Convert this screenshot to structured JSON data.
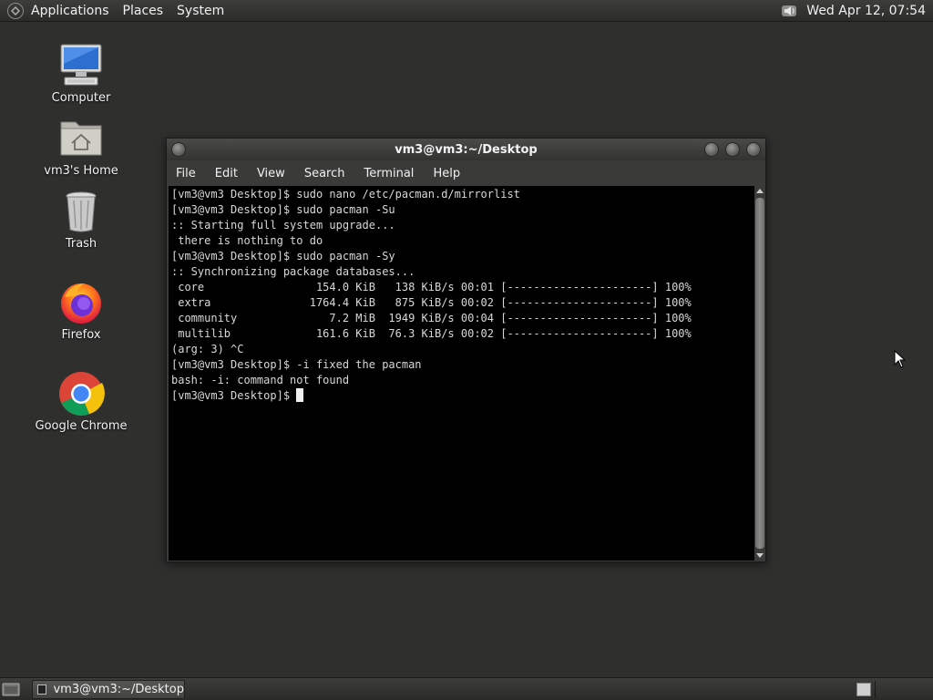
{
  "top_panel": {
    "menus": [
      "Applications",
      "Places",
      "System"
    ],
    "clock": "Wed Apr 12, 07:54"
  },
  "desktop": {
    "icons": [
      {
        "label": "Computer",
        "icon": "computer-icon"
      },
      {
        "label": "vm3's Home",
        "icon": "home-folder-icon"
      },
      {
        "label": "Trash",
        "icon": "trash-icon"
      },
      {
        "label": "Firefox",
        "icon": "firefox-icon"
      },
      {
        "label": "Google Chrome",
        "icon": "chrome-icon"
      }
    ]
  },
  "terminal": {
    "title": "vm3@vm3:~/Desktop",
    "menu": [
      "File",
      "Edit",
      "View",
      "Search",
      "Terminal",
      "Help"
    ],
    "lines": [
      "[vm3@vm3 Desktop]$ sudo nano /etc/pacman.d/mirrorlist",
      "[vm3@vm3 Desktop]$ sudo pacman -Su",
      ":: Starting full system upgrade...",
      " there is nothing to do",
      "[vm3@vm3 Desktop]$ sudo pacman -Sy",
      ":: Synchronizing package databases...",
      " core                 154.0 KiB   138 KiB/s 00:01 [----------------------] 100%",
      " extra               1764.4 KiB   875 KiB/s 00:02 [----------------------] 100%",
      " community              7.2 MiB  1949 KiB/s 00:04 [----------------------] 100%",
      " multilib             161.6 KiB  76.3 KiB/s 00:02 [----------------------] 100%",
      "(arg: 3) ^C",
      "[vm3@vm3 Desktop]$ -i fixed the pacman",
      "bash: -i: command not found"
    ],
    "prompt": "[vm3@vm3 Desktop]$ "
  },
  "taskbar": {
    "window_button": "vm3@vm3:~/Desktop"
  }
}
